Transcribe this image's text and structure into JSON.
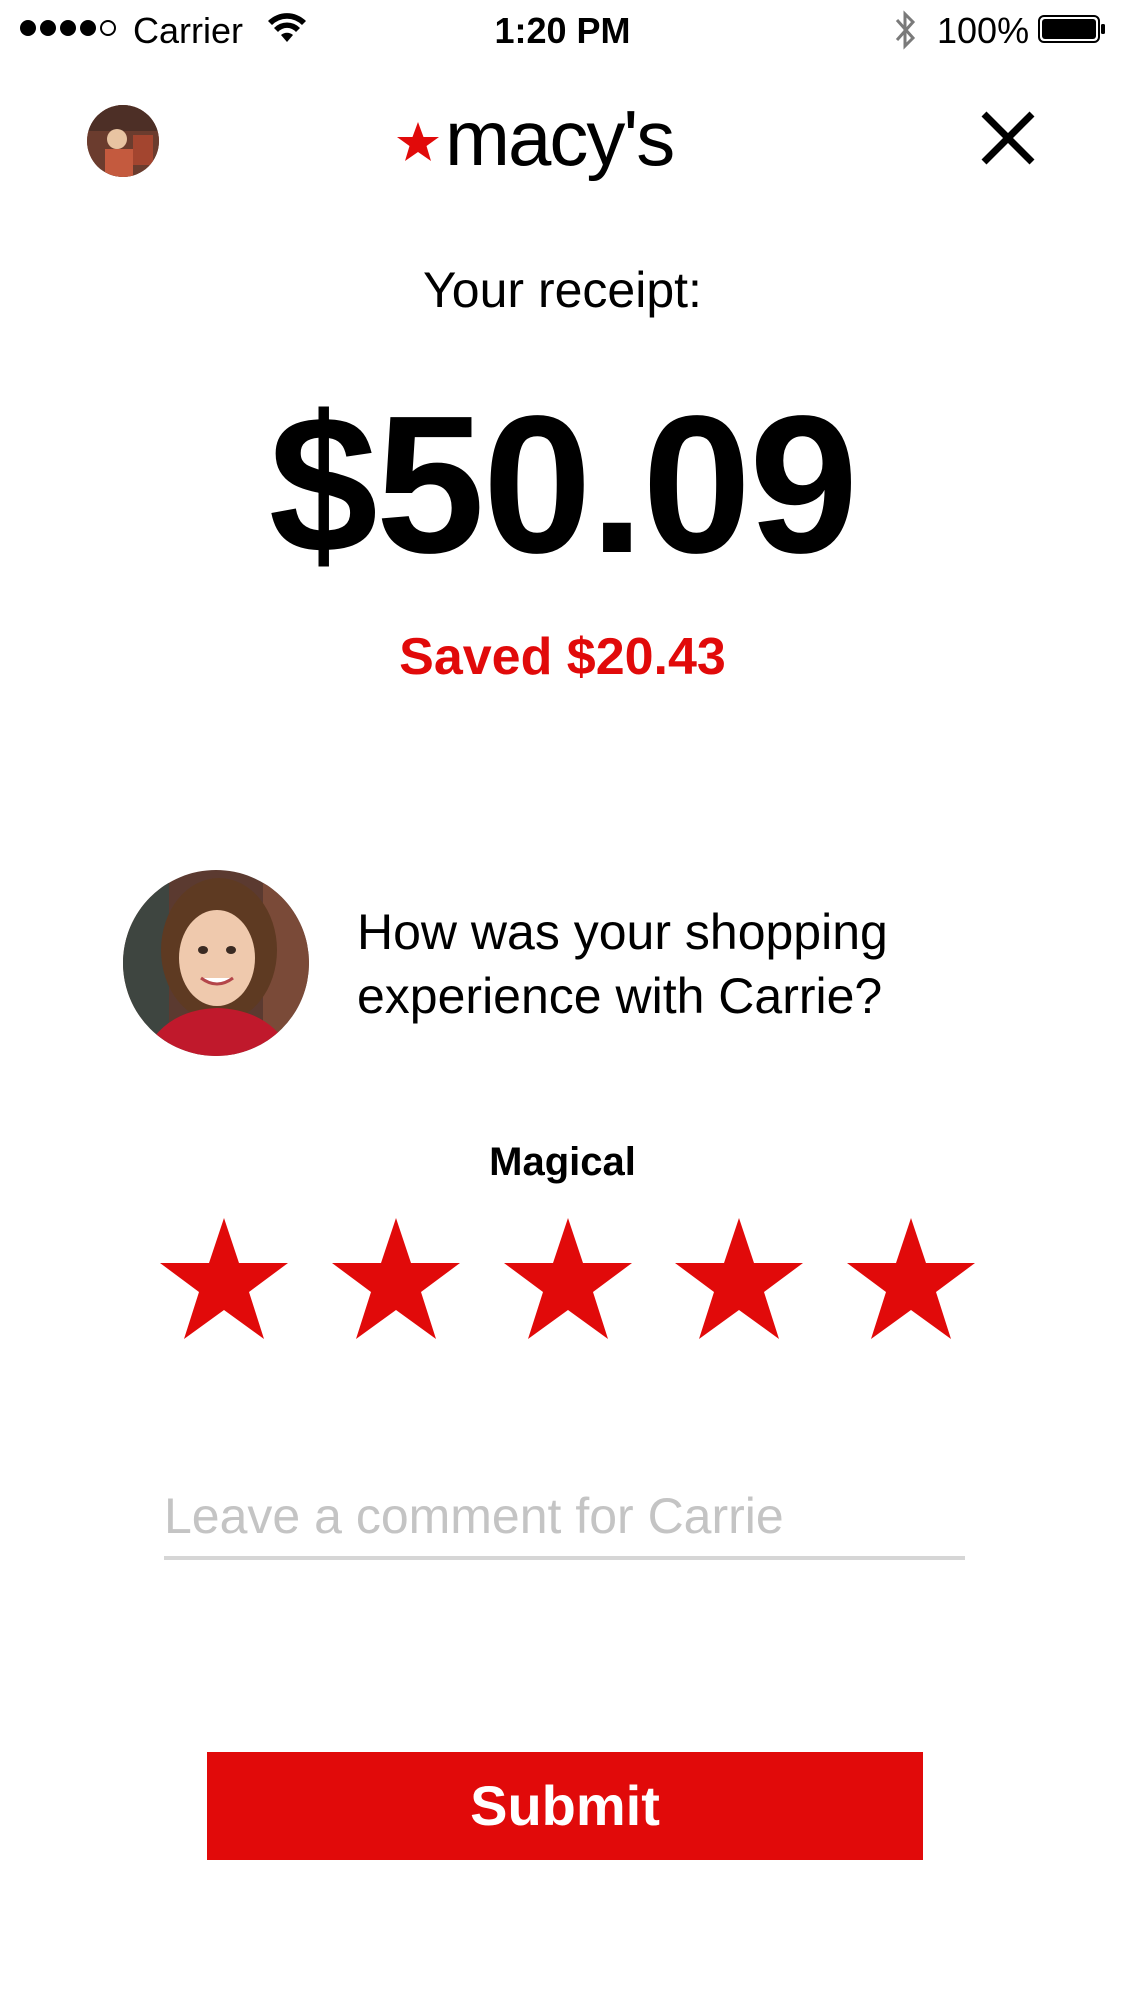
{
  "status_bar": {
    "signal_bars": 4,
    "signal_total": 5,
    "carrier": "Carrier",
    "wifi_icon": "wifi-icon",
    "time": "1:20 PM",
    "bluetooth_icon": "bluetooth-icon",
    "battery_percent": "100%",
    "battery_icon": "battery-icon",
    "battery_level": 1.0
  },
  "nav": {
    "avatar_icon": "user-avatar",
    "logo_text": "macy's",
    "close_icon": "close-icon"
  },
  "receipt": {
    "title": "Your receipt:",
    "amount": "$50.09",
    "saved": "Saved $20.43"
  },
  "feedback": {
    "associate_avatar": "associate-photo",
    "question": "How was your shopping experience with Carrie?",
    "rating_label": "Magical",
    "rating": 5,
    "max_rating": 5,
    "star_icon": "star-icon",
    "comment_placeholder": "Leave a comment for Carrie",
    "comment_value": ""
  },
  "actions": {
    "submit_label": "Submit"
  },
  "colors": {
    "brand_red": "#e10a0a",
    "text": "#000000",
    "placeholder": "#c4c4c4",
    "underline": "#d6d6d6",
    "background": "#ffffff"
  }
}
